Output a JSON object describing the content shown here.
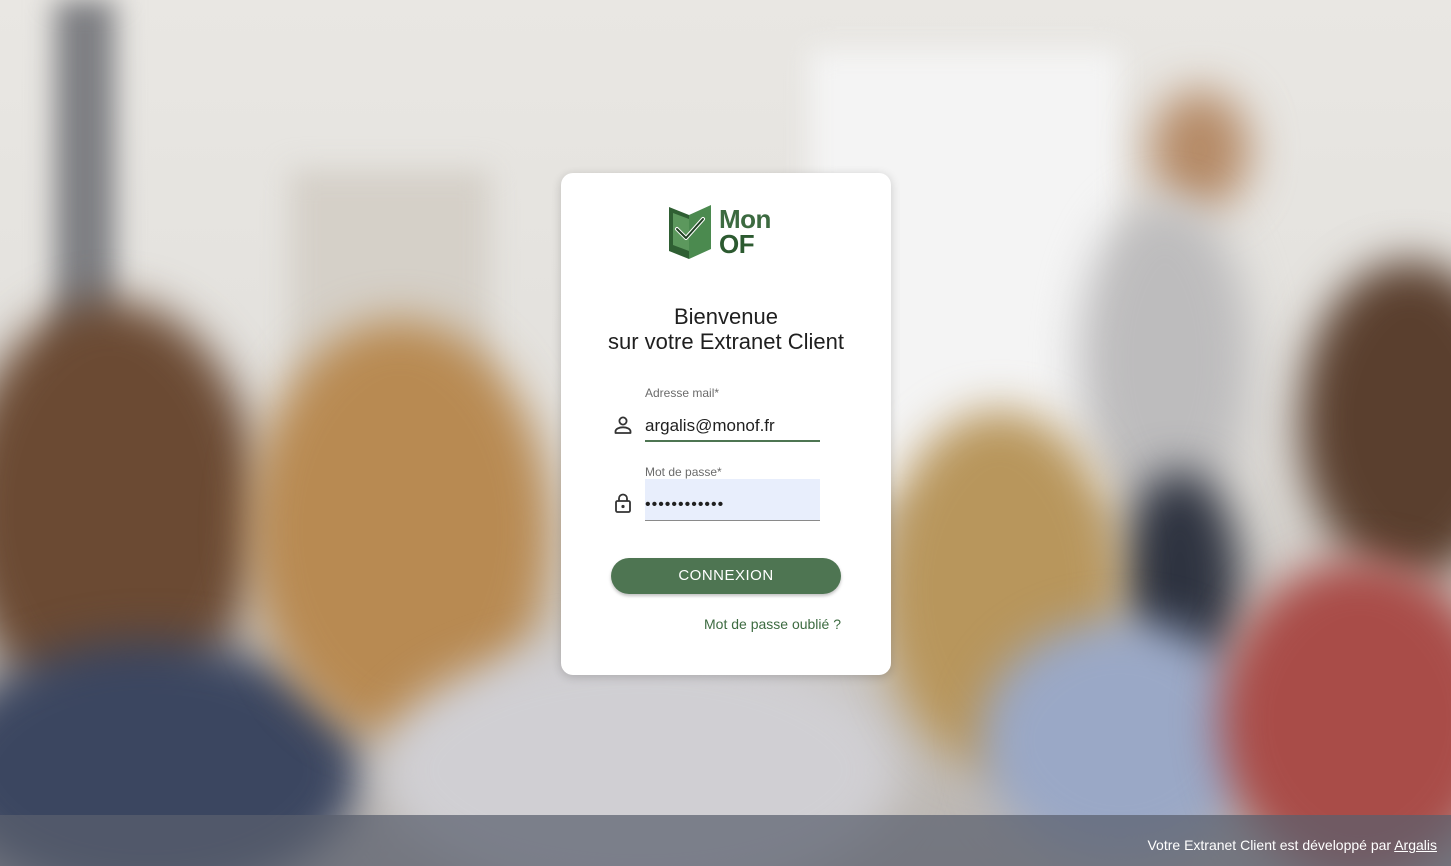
{
  "brand": {
    "name_line1": "Mon",
    "name_line2": "OF",
    "color_primary": "#4e7552"
  },
  "welcome": {
    "line1": "Bienvenue",
    "line2": "sur votre Extranet Client"
  },
  "form": {
    "email": {
      "label": "Adresse mail*",
      "value": "argalis@monof.fr",
      "icon": "person-icon"
    },
    "password": {
      "label": "Mot de passe*",
      "value": "••••••••••••",
      "icon": "lock-icon"
    },
    "submit_label": "CONNEXION",
    "forgot_label": "Mot de passe oublié ?"
  },
  "footer": {
    "text": "Votre Extranet Client est développé par ",
    "link_label": "Argalis"
  }
}
